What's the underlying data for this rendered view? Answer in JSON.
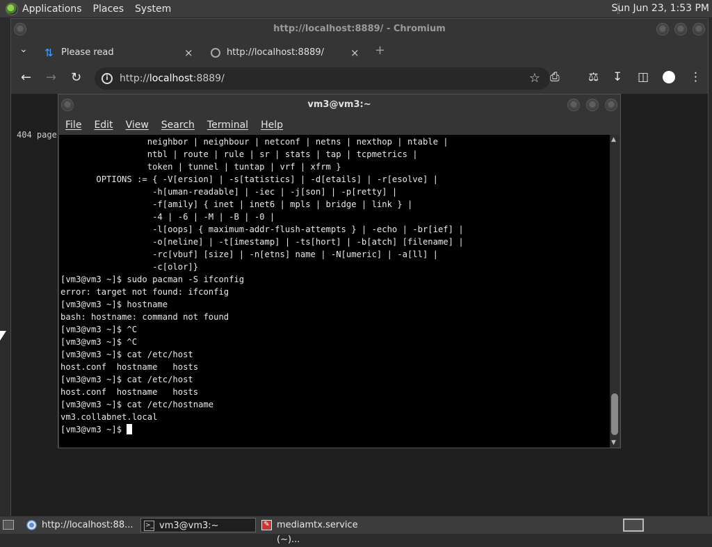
{
  "top_panel": {
    "menus": [
      "Applications",
      "Places",
      "System"
    ],
    "clock": "Sun Jun 23,  1:53 PM"
  },
  "browser": {
    "window_title": "http://localhost:8889/ - Chromium",
    "tabs": [
      {
        "label": "Please read"
      },
      {
        "label": "http://localhost:8889/"
      }
    ],
    "tab_close_glyph": "×",
    "new_tab_glyph": "+",
    "address": {
      "host": "localhost",
      "prefix": "http://",
      "suffix": ":8889/"
    },
    "page_text": "404 page"
  },
  "terminal": {
    "title": "vm3@vm3:~",
    "menu": [
      "File",
      "Edit",
      "View",
      "Search",
      "Terminal",
      "Help"
    ],
    "lines": [
      "                 neighbor | neighbour | netconf | netns | nexthop | ntable |",
      "                 ntbl | route | rule | sr | stats | tap | tcpmetrics |",
      "                 token | tunnel | tuntap | vrf | xfrm }",
      "       OPTIONS := { -V[ersion] | -s[tatistics] | -d[etails] | -r[esolve] |",
      "                  -h[uman-readable] | -iec | -j[son] | -p[retty] |",
      "                  -f[amily] { inet | inet6 | mpls | bridge | link } |",
      "                  -4 | -6 | -M | -B | -0 |",
      "                  -l[oops] { maximum-addr-flush-attempts } | -echo | -br[ief] |",
      "                  -o[neline] | -t[imestamp] | -ts[hort] | -b[atch] [filename] |",
      "                  -rc[vbuf] [size] | -n[etns] name | -N[umeric] | -a[ll] |",
      "                  -c[olor]}",
      "[vm3@vm3 ~]$ sudo pacman -S ifconfig",
      "error: target not found: ifconfig",
      "[vm3@vm3 ~]$ hostname",
      "bash: hostname: command not found",
      "[vm3@vm3 ~]$ ^C",
      "[vm3@vm3 ~]$ ^C",
      "[vm3@vm3 ~]$ cat /etc/host",
      "host.conf  hostname   hosts",
      "[vm3@vm3 ~]$ cat /etc/host",
      "host.conf  hostname   hosts",
      "[vm3@vm3 ~]$ cat /etc/hostname",
      "vm3.collabnet.local"
    ],
    "prompt": "[vm3@vm3 ~]$ "
  },
  "taskbar": {
    "tasks": [
      {
        "label": "http://localhost:88...",
        "icon": "chromium-icon"
      },
      {
        "label": "vm3@vm3:~",
        "icon": "terminal-icon",
        "active": true
      },
      {
        "label": "mediamtx.service (~)...",
        "icon": "text-editor-icon"
      }
    ]
  },
  "colors": {
    "panel": "#3c3c3c",
    "terminal_bg": "#000000",
    "terminal_fg": "#e8e8e8",
    "accent": "#4aa0ff"
  }
}
